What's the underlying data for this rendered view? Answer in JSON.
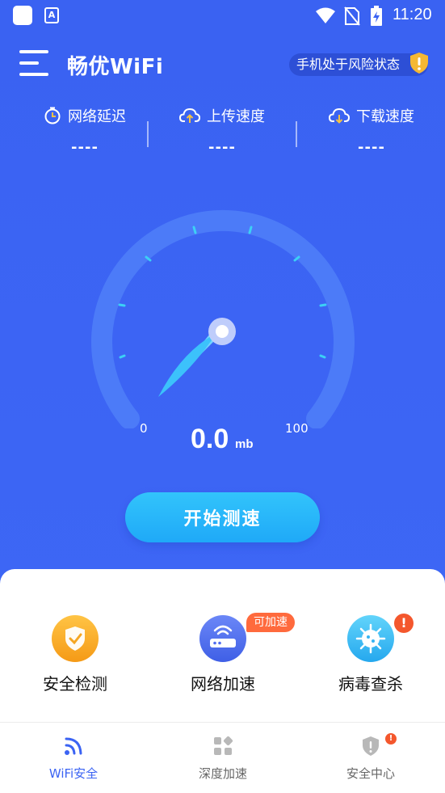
{
  "status_bar": {
    "time": "11:20",
    "notification_icon": "A"
  },
  "header": {
    "title": "畅优WiFi",
    "risk_text": "手机处于风险状态"
  },
  "metrics": [
    {
      "label": "网络延迟",
      "value": "----",
      "icon": "clock-icon"
    },
    {
      "label": "上传速度",
      "value": "----",
      "icon": "upload-cloud-icon"
    },
    {
      "label": "下载速度",
      "value": "----",
      "icon": "download-cloud-icon"
    }
  ],
  "gauge": {
    "min_label": "0",
    "max_label": "100",
    "value": "0.0",
    "unit": "mb"
  },
  "start_button": "开始测速",
  "tools": [
    {
      "label": "安全检测",
      "icon": "shield-check-icon"
    },
    {
      "label": "网络加速",
      "icon": "router-icon",
      "badge": "可加速"
    },
    {
      "label": "病毒查杀",
      "icon": "virus-icon",
      "alert": "!"
    }
  ],
  "bottom_nav": [
    {
      "label": "WiFi安全",
      "icon": "wifi-icon",
      "active": true
    },
    {
      "label": "深度加速",
      "icon": "grid-icon",
      "active": false
    },
    {
      "label": "安全中心",
      "icon": "shield-icon",
      "active": false,
      "alert": "!"
    }
  ],
  "colors": {
    "primary": "#3b63f3",
    "accent": "#29b6f9",
    "badge": "#ff6a3d",
    "nav_active": "#3b63f3",
    "nav_inactive": "#666666"
  }
}
